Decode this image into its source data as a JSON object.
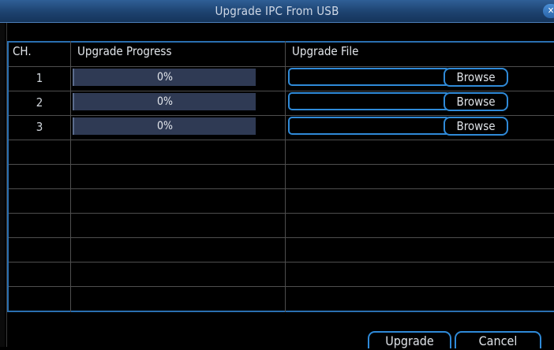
{
  "window": {
    "title": "Upgrade IPC From USB",
    "close_icon": "close-icon"
  },
  "table": {
    "headers": {
      "channel": "CH.",
      "progress": "Upgrade Progress",
      "file": "Upgrade File"
    },
    "rows": [
      {
        "ch": "1",
        "progress_label": "0%",
        "progress_value": 0,
        "file": "",
        "browse": "Browse"
      },
      {
        "ch": "2",
        "progress_label": "0%",
        "progress_value": 0,
        "file": "",
        "browse": "Browse"
      },
      {
        "ch": "3",
        "progress_label": "0%",
        "progress_value": 0,
        "file": "",
        "browse": "Browse"
      }
    ],
    "empty_rows": 7
  },
  "footer": {
    "upgrade_label": "Upgrade",
    "cancel_label": "Cancel"
  },
  "colors": {
    "accent": "#2f8ad8",
    "titlebar": "#1d426f",
    "progress_track": "#2f3a54"
  }
}
